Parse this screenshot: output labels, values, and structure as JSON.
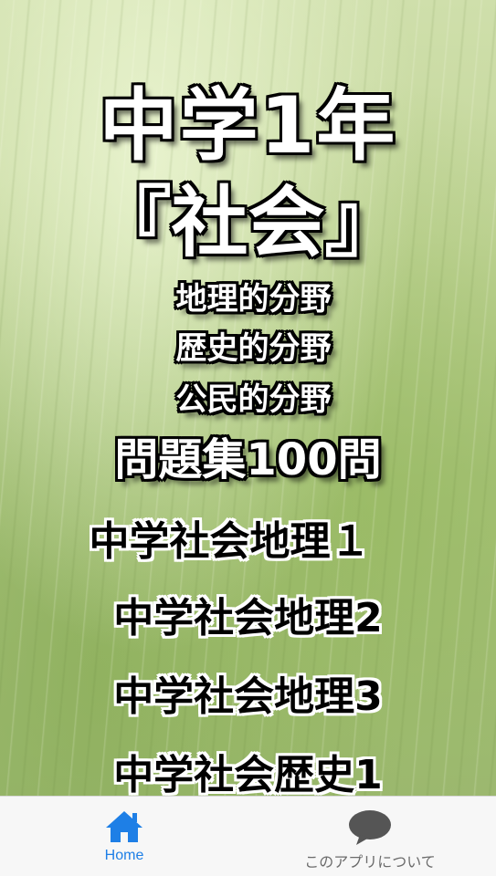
{
  "hero": {
    "line1": "中学1年",
    "line2": "『社会』",
    "sub1": "地理的分野",
    "sub2": "歴史的分野",
    "sub3": "公民的分野",
    "line3": "問題集100問"
  },
  "menu": {
    "items": [
      {
        "label": "中学社会地理１"
      },
      {
        "label": "中学社会地理2"
      },
      {
        "label": "中学社会地理3"
      },
      {
        "label": "中学社会歴史1"
      }
    ]
  },
  "tabbar": {
    "home_label": "Home",
    "about_label": "このアプリについて",
    "home_icon": "home-icon",
    "about_icon": "speech-bubble-icon",
    "active_color": "#1e7fe6",
    "inactive_color": "#6b6b6b"
  }
}
